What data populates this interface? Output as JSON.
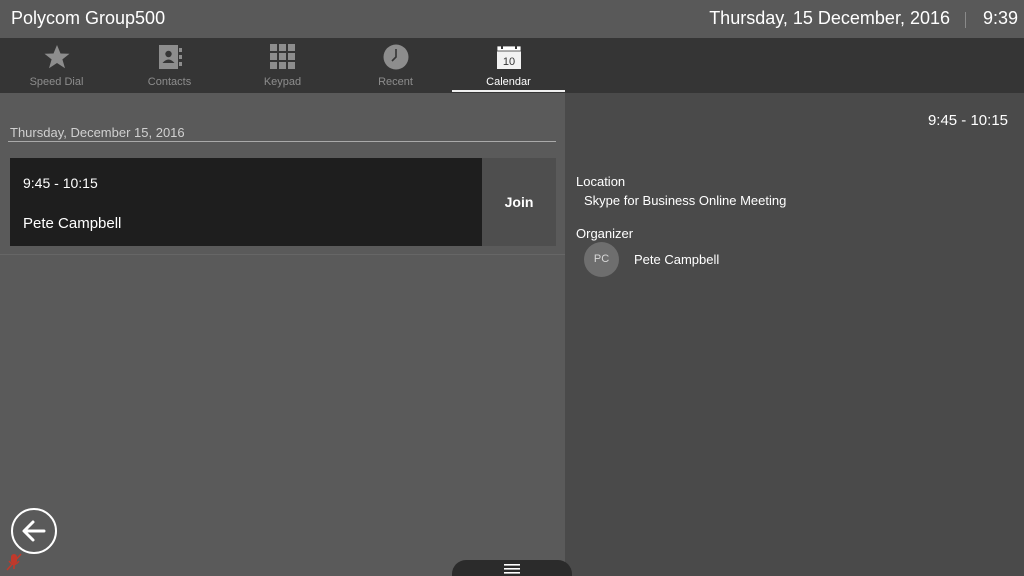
{
  "header": {
    "app_title": "Polycom Group500",
    "date": "Thursday, 15 December, 2016",
    "time": "9:39"
  },
  "tabs": [
    {
      "label": "Speed Dial",
      "icon": "star-icon"
    },
    {
      "label": "Contacts",
      "icon": "contacts-icon"
    },
    {
      "label": "Keypad",
      "icon": "keypad-icon"
    },
    {
      "label": "Recent",
      "icon": "clock-icon"
    },
    {
      "label": "Calendar",
      "icon": "calendar-icon",
      "icon_text": "10",
      "active": true
    }
  ],
  "calendar": {
    "date_heading": "Thursday, December 15, 2016",
    "meeting": {
      "time": "9:45 - 10:15",
      "organizer": "Pete Campbell",
      "join_label": "Join"
    }
  },
  "details": {
    "time": "9:45 - 10:15",
    "location_label": "Location",
    "location_value": "Skype for Business Online Meeting",
    "organizer_label": "Organizer",
    "organizer_initials": "PC",
    "organizer_name": "Pete Campbell"
  },
  "colors": {
    "topbar": "#595959",
    "tabbar": "#353535",
    "left_panel": "#5a5a5a",
    "right_panel": "#4a4a4a",
    "meeting_card": "#1e1e1e",
    "mic_muted": "#c0392b"
  }
}
